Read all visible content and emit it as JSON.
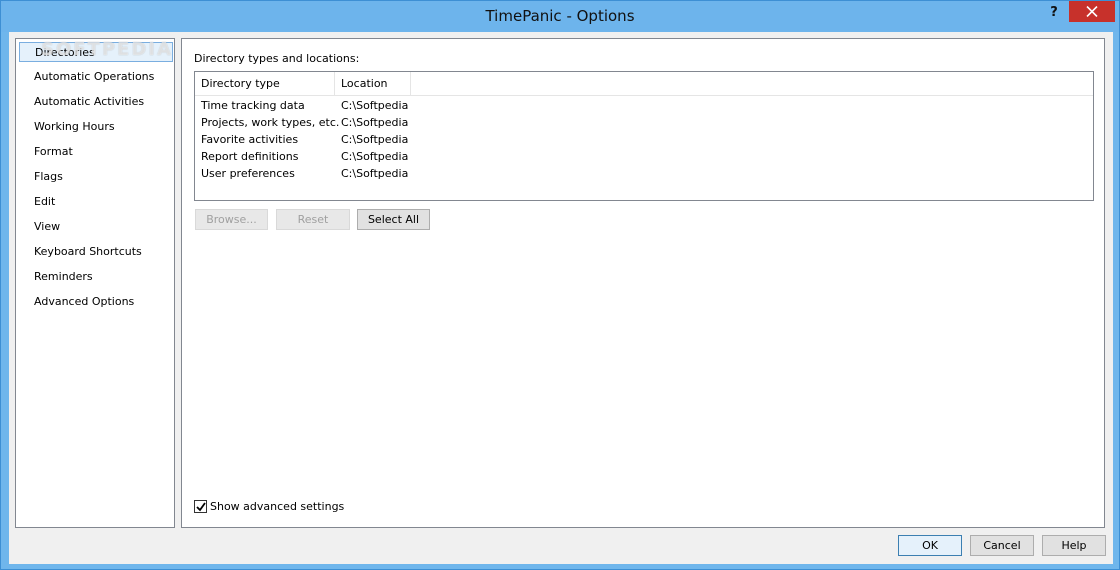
{
  "window": {
    "title": "TimePanic - Options",
    "help_glyph": "?",
    "watermark": "SOFTPEDIA"
  },
  "sidebar": {
    "items": [
      {
        "label": "Directories",
        "selected": true
      },
      {
        "label": "Automatic Operations"
      },
      {
        "label": "Automatic Activities"
      },
      {
        "label": "Working Hours"
      },
      {
        "label": "Format"
      },
      {
        "label": "Flags"
      },
      {
        "label": "Edit"
      },
      {
        "label": "View"
      },
      {
        "label": "Keyboard Shortcuts"
      },
      {
        "label": "Reminders"
      },
      {
        "label": "Advanced Options"
      }
    ]
  },
  "directories": {
    "section_label": "Directory types and locations:",
    "columns": [
      "Directory type",
      "Location"
    ],
    "rows": [
      {
        "type": "Time tracking data",
        "location": "C:\\Softpedia"
      },
      {
        "type": "Projects, work types, etc.",
        "location": "C:\\Softpedia"
      },
      {
        "type": "Favorite activities",
        "location": "C:\\Softpedia"
      },
      {
        "type": "Report definitions",
        "location": "C:\\Softpedia"
      },
      {
        "type": "User preferences",
        "location": "C:\\Softpedia"
      }
    ],
    "buttons": {
      "browse": "Browse...",
      "reset": "Reset",
      "select_all": "Select All"
    },
    "show_advanced": {
      "label": "Show advanced settings",
      "checked": true
    }
  },
  "footer": {
    "ok": "OK",
    "cancel": "Cancel",
    "help": "Help"
  }
}
